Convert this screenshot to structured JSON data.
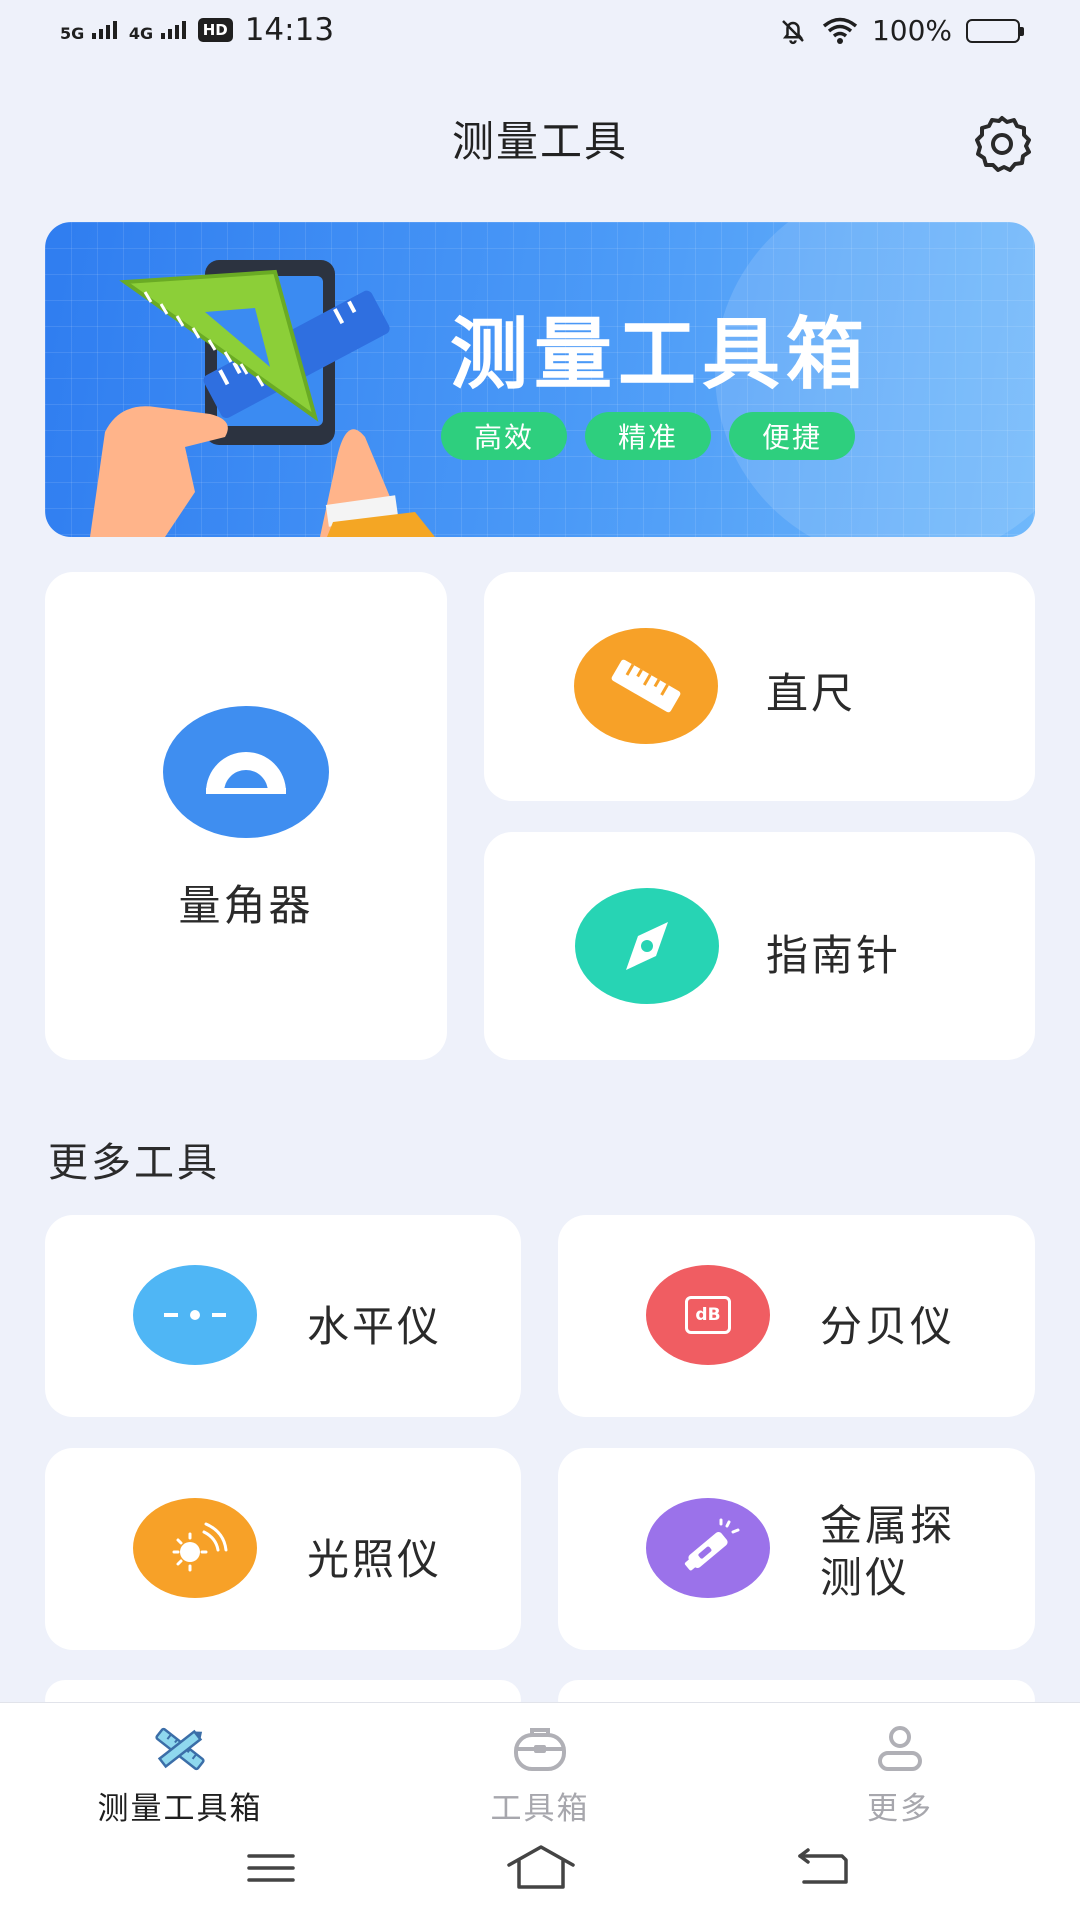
{
  "status_bar": {
    "net1": "5G",
    "net2": "4G",
    "hd": "HD",
    "time": "14:13",
    "battery": "100%"
  },
  "header": {
    "title": "测量工具"
  },
  "banner": {
    "title": "测量工具箱",
    "tags": [
      "高效",
      "精准",
      "便捷"
    ]
  },
  "main_tools": [
    {
      "label": "量角器",
      "icon": "protractor-icon",
      "color": "#3f8ef0"
    },
    {
      "label": "直尺",
      "icon": "ruler-icon",
      "color": "#f7a128"
    },
    {
      "label": "指南针",
      "icon": "compass-icon",
      "color": "#27d4b4"
    }
  ],
  "more_tools": {
    "title": "更多工具",
    "items": [
      {
        "label": "水平仪",
        "icon": "level-icon",
        "color": "#4fb6f5"
      },
      {
        "label": "分贝仪",
        "icon": "decibel-icon",
        "color": "#f05d62",
        "icon_text": "dB"
      },
      {
        "label": "光照仪",
        "icon": "light-meter-icon",
        "color": "#f7a128"
      },
      {
        "label": "金属探测仪",
        "label_line1": "金属探",
        "label_line2": "测仪",
        "icon": "metal-detector-icon",
        "color": "#9b72ea"
      }
    ]
  },
  "bottom_nav": [
    {
      "label": "测量工具箱",
      "icon": "ruler-pencil-icon",
      "active": true
    },
    {
      "label": "工具箱",
      "icon": "toolbox-icon",
      "active": false
    },
    {
      "label": "更多",
      "icon": "user-icon",
      "active": false
    }
  ],
  "colors": {
    "active": "#1f1f1f",
    "inactive": "#a7a7ad",
    "accent": "#2f7df0"
  }
}
